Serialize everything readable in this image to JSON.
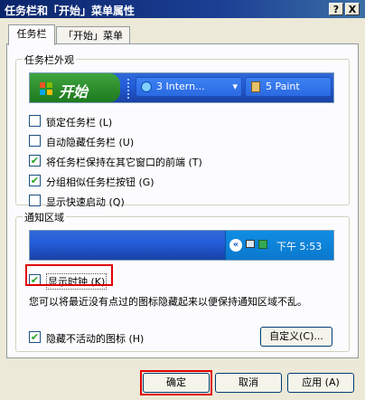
{
  "window": {
    "title": "任务栏和「开始」菜单属性",
    "help_button": "?",
    "close_button": "X"
  },
  "tabs": [
    {
      "label": "任务栏",
      "active": true
    },
    {
      "label": "「开始」菜单",
      "active": false
    }
  ],
  "appearance": {
    "group_title": "任务栏外观",
    "preview": {
      "start_label": "开始",
      "task1_label": "3 Intern...",
      "task2_label": "5 Paint"
    },
    "options": [
      {
        "label": "锁定任务栏 (L)",
        "checked": false
      },
      {
        "label": "自动隐藏任务栏 (U)",
        "checked": false
      },
      {
        "label": "将任务栏保持在其它窗口的前端 (T)",
        "checked": true
      },
      {
        "label": "分组相似任务栏按钮 (G)",
        "checked": true
      },
      {
        "label": "显示快速启动 (Q)",
        "checked": false
      }
    ]
  },
  "notification": {
    "group_title": "通知区域",
    "clock_text": "下午 5:53",
    "show_clock": {
      "label": "显示时钟 (K)",
      "checked": true
    },
    "description": "您可以将最近没有点过的图标隐藏起来以便保持通知区域不乱。",
    "hide_inactive": {
      "label": "隐藏不活动的图标 (H)",
      "checked": true
    },
    "customize_label": "自定义(C)..."
  },
  "buttons": {
    "ok": "确定",
    "cancel": "取消",
    "apply": "应用 (A)"
  },
  "colors": {
    "title_bar": "#0a246a",
    "highlight_box": "#e00000",
    "taskbar": "#245edb",
    "start_button": "#2e8e2e"
  }
}
